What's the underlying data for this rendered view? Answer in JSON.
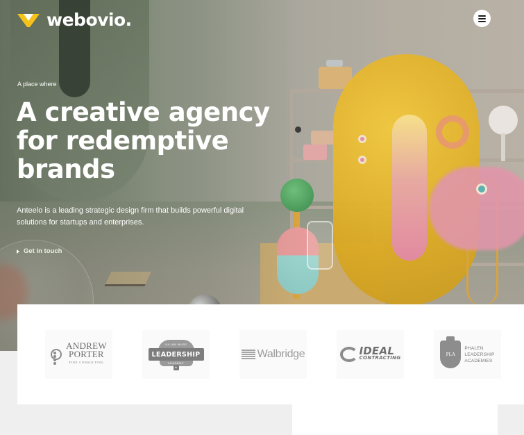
{
  "brand": {
    "name": "webovio.",
    "accent": "#f5c21a",
    "logo_icon": "w-chevron-icon"
  },
  "header": {
    "menu_icon": "hamburger-menu-icon"
  },
  "hero": {
    "eyebrow": "A place where",
    "headline": "A creative agency for redemptive brands",
    "subtext": "Anteelo is a leading strategic design firm that builds powerful digital solutions for startups and enterprises.",
    "cta_label": "Get in touch",
    "cta_icon": "triangle-arrow-icon"
  },
  "clients": {
    "logos": [
      {
        "name": "ANDREW PORTER",
        "line1": "ANDREW",
        "line2": "PORTER",
        "tagline": "FINE CONSULTING"
      },
      {
        "name": "LEADERSHIP ACADEMY",
        "banner": "LEADERSHIP",
        "top": "JULIAN MUSE",
        "bottom": "ACADEMY",
        "star": "★"
      },
      {
        "name": "Walbridge",
        "text": "Walbridge"
      },
      {
        "name": "IDEAL CONTRACTING",
        "line1": "IDEAL",
        "line2": "CONTRACTING"
      },
      {
        "name": "PHALEN LEADERSHIP ACADEMIES",
        "line1": "PHALEN",
        "line2": "LEADERSHIP",
        "line3": "ACADEMIES",
        "crest": "PLA"
      }
    ]
  }
}
